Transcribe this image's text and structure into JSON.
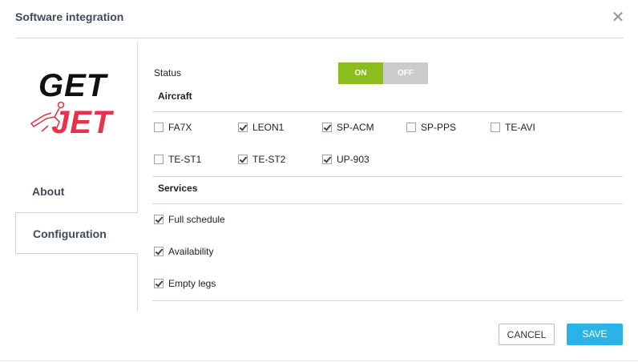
{
  "dialog": {
    "title": "Software integration",
    "close_label": "✕"
  },
  "logo": {
    "line1": "GET",
    "line2": "JET"
  },
  "nav": {
    "about": "About",
    "configuration": "Configuration"
  },
  "status": {
    "label": "Status",
    "on_label": "ON",
    "off_label": "OFF",
    "value": "ON"
  },
  "aircraft": {
    "heading": "Aircraft",
    "items": [
      {
        "label": "FA7X",
        "checked": false
      },
      {
        "label": "LEON1",
        "checked": true
      },
      {
        "label": "SP-ACM",
        "checked": true
      },
      {
        "label": "SP-PPS",
        "checked": false
      },
      {
        "label": "TE-AVI",
        "checked": false
      },
      {
        "label": "TE-ST1",
        "checked": false
      },
      {
        "label": "TE-ST2",
        "checked": true
      },
      {
        "label": "UP-903",
        "checked": true
      }
    ]
  },
  "services": {
    "heading": "Services",
    "items": [
      {
        "label": "Full schedule",
        "checked": true
      },
      {
        "label": "Availability",
        "checked": true
      },
      {
        "label": "Empty legs",
        "checked": true
      }
    ]
  },
  "buttons": {
    "cancel": "CANCEL",
    "save": "SAVE"
  },
  "colors": {
    "accent_green": "#8cbd1e",
    "save_blue": "#29b3e6",
    "brand_red": "#e8324a"
  }
}
